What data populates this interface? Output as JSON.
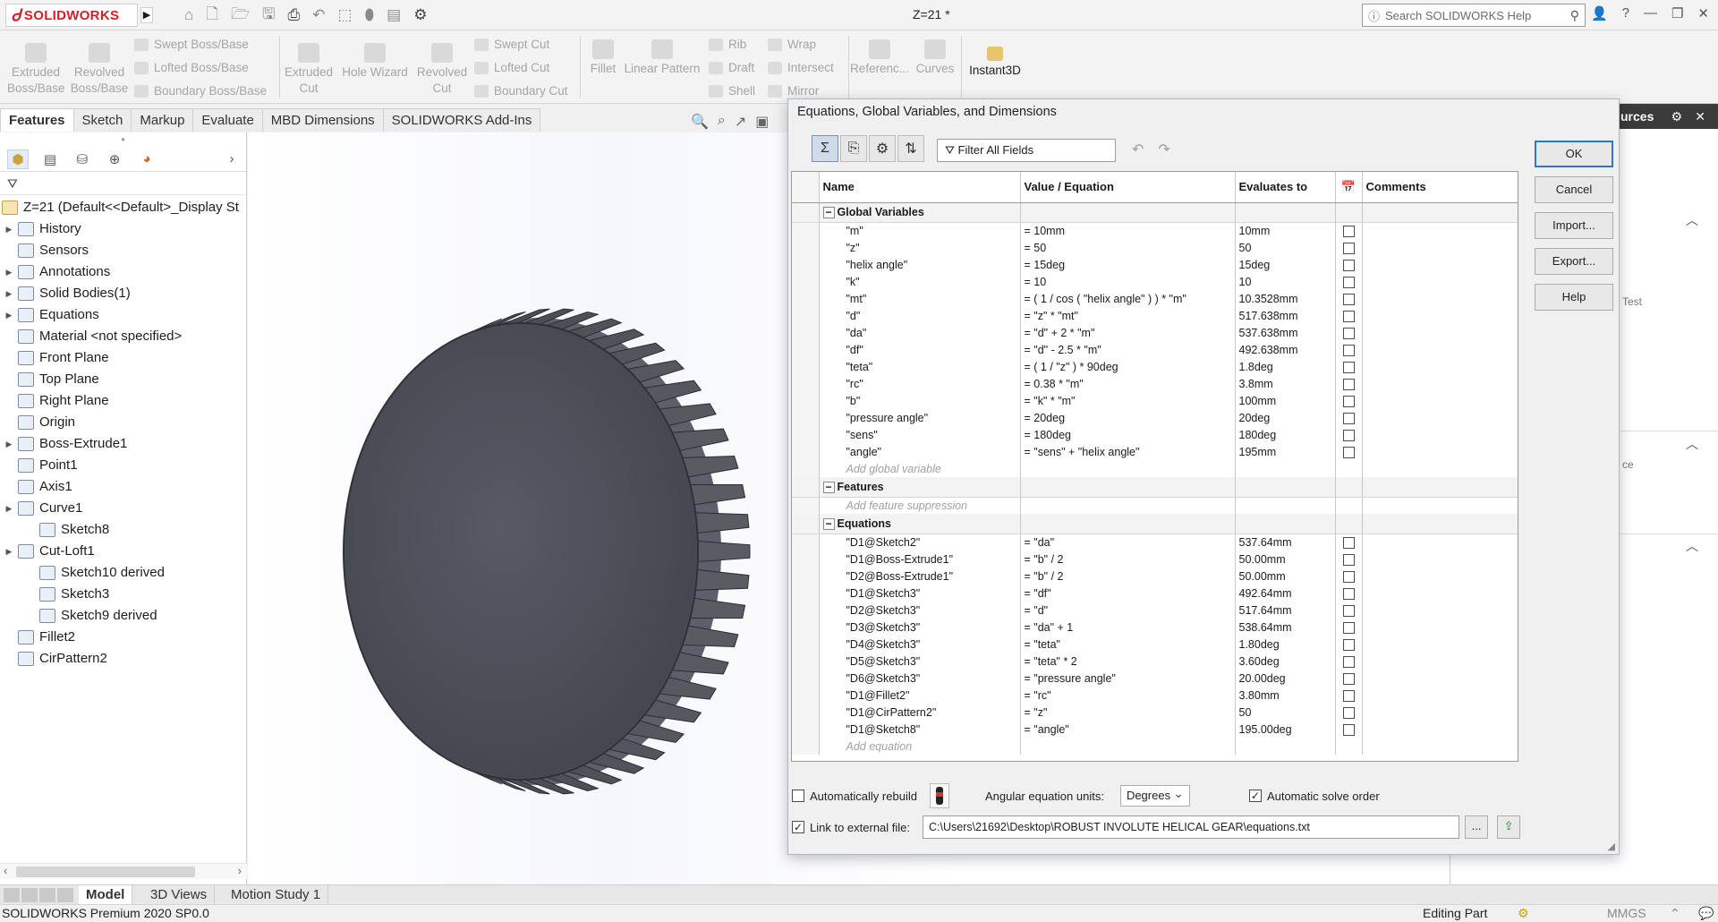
{
  "app": {
    "logo_text": "SOLIDWORKS",
    "document_title": "Z=21 *",
    "search_placeholder": "Search SOLIDWORKS Help"
  },
  "command_manager": {
    "extruded_boss": "Extruded\nBoss/Base",
    "revolved_boss": "Revolved\nBoss/Base",
    "swept_boss": "Swept Boss/Base",
    "lofted_boss": "Lofted Boss/Base",
    "boundary_boss": "Boundary Boss/Base",
    "extruded_cut": "Extruded\nCut",
    "hole_wizard": "Hole Wizard",
    "revolved_cut": "Revolved\nCut",
    "swept_cut": "Swept Cut",
    "lofted_cut": "Lofted Cut",
    "boundary_cut": "Boundary Cut",
    "fillet": "Fillet",
    "linear_pattern": "Linear Pattern",
    "rib": "Rib",
    "draft": "Draft",
    "shell": "Shell",
    "wrap": "Wrap",
    "intersect": "Intersect",
    "mirror": "Mirror",
    "reference": "Referenc...",
    "curves": "Curves",
    "instant3d": "Instant3D"
  },
  "tabs": [
    "Features",
    "Sketch",
    "Markup",
    "Evaluate",
    "MBD Dimensions",
    "SOLIDWORKS Add-Ins"
  ],
  "feature_tree": {
    "root": "Z=21  (Default<<Default>_Display St",
    "items": [
      {
        "label": "History",
        "expand": true,
        "indent": 0
      },
      {
        "label": "Sensors",
        "expand": false,
        "indent": 0
      },
      {
        "label": "Annotations",
        "expand": true,
        "indent": 0
      },
      {
        "label": "Solid Bodies(1)",
        "expand": true,
        "indent": 0
      },
      {
        "label": "Equations",
        "expand": true,
        "indent": 0
      },
      {
        "label": "Material <not specified>",
        "expand": false,
        "indent": 0
      },
      {
        "label": "Front Plane",
        "expand": false,
        "indent": 0
      },
      {
        "label": "Top Plane",
        "expand": false,
        "indent": 0
      },
      {
        "label": "Right Plane",
        "expand": false,
        "indent": 0
      },
      {
        "label": "Origin",
        "expand": false,
        "indent": 0
      },
      {
        "label": "Boss-Extrude1",
        "expand": true,
        "indent": 0
      },
      {
        "label": "Point1",
        "expand": false,
        "indent": 0
      },
      {
        "label": "Axis1",
        "expand": false,
        "indent": 0
      },
      {
        "label": "Curve1",
        "expand": true,
        "indent": 0
      },
      {
        "label": "Sketch8",
        "expand": false,
        "indent": 1
      },
      {
        "label": "Cut-Loft1",
        "expand": true,
        "indent": 0
      },
      {
        "label": "Sketch10 derived",
        "expand": false,
        "indent": 1
      },
      {
        "label": "Sketch3",
        "expand": false,
        "indent": 1
      },
      {
        "label": "Sketch9 derived",
        "expand": false,
        "indent": 1
      },
      {
        "label": "Fillet2",
        "expand": false,
        "indent": 0
      },
      {
        "label": "CirPattern2",
        "expand": false,
        "indent": 0
      }
    ]
  },
  "dialog": {
    "title": "Equations, Global Variables, and Dimensions",
    "filter_label": "Filter All Fields",
    "columns": {
      "name": "Name",
      "value": "Value / Equation",
      "evaluates": "Evaluates to",
      "comments": "Comments"
    },
    "sections": {
      "global_variables": "Global Variables",
      "features": "Features",
      "equations": "Equations"
    },
    "global_variables": [
      {
        "name": "\"m\"",
        "value": "= 10mm",
        "eval": "10mm"
      },
      {
        "name": "\"z\"",
        "value": "= 50",
        "eval": "50"
      },
      {
        "name": "\"helix angle\"",
        "value": "= 15deg",
        "eval": "15deg"
      },
      {
        "name": "\"k\"",
        "value": "= 10",
        "eval": "10"
      },
      {
        "name": "\"mt\"",
        "value": "= ( 1 / cos ( \"helix angle\" ) ) * \"m\"",
        "eval": "10.3528mm"
      },
      {
        "name": "\"d\"",
        "value": "= \"z\" * \"mt\"",
        "eval": "517.638mm"
      },
      {
        "name": "\"da\"",
        "value": "= \"d\" + 2 * \"m\"",
        "eval": "537.638mm"
      },
      {
        "name": "\"df\"",
        "value": "= \"d\" - 2.5 * \"m\"",
        "eval": "492.638mm"
      },
      {
        "name": "\"teta\"",
        "value": "= ( 1 / \"z\" ) * 90deg",
        "eval": "1.8deg"
      },
      {
        "name": "\"rc\"",
        "value": "= 0.38 * \"m\"",
        "eval": "3.8mm"
      },
      {
        "name": "\"b\"",
        "value": "= \"k\" * \"m\"",
        "eval": "100mm"
      },
      {
        "name": "\"pressure angle\"",
        "value": "= 20deg",
        "eval": "20deg"
      },
      {
        "name": "\"sens\"",
        "value": "= 180deg",
        "eval": "180deg"
      },
      {
        "name": "\"angle\"",
        "value": "= \"sens\" + \"helix angle\"",
        "eval": "195mm"
      }
    ],
    "add_global_variable": "Add global variable",
    "add_feature_suppression": "Add feature suppression",
    "equations": [
      {
        "name": "\"D1@Sketch2\"",
        "value": "= \"da\"",
        "eval": "537.64mm"
      },
      {
        "name": "\"D1@Boss-Extrude1\"",
        "value": "= \"b\" / 2",
        "eval": "50.00mm"
      },
      {
        "name": "\"D2@Boss-Extrude1\"",
        "value": "= \"b\" / 2",
        "eval": "50.00mm"
      },
      {
        "name": "\"D1@Sketch3\"",
        "value": "= \"df\"",
        "eval": "492.64mm"
      },
      {
        "name": "\"D2@Sketch3\"",
        "value": "= \"d\"",
        "eval": "517.64mm"
      },
      {
        "name": "\"D3@Sketch3\"",
        "value": "= \"da\" + 1",
        "eval": "538.64mm"
      },
      {
        "name": "\"D4@Sketch3\"",
        "value": "= \"teta\"",
        "eval": "1.80deg"
      },
      {
        "name": "\"D5@Sketch3\"",
        "value": "= \"teta\" * 2",
        "eval": "3.60deg"
      },
      {
        "name": "\"D6@Sketch3\"",
        "value": "= \"pressure angle\"",
        "eval": "20.00deg"
      },
      {
        "name": "\"D1@Fillet2\"",
        "value": "= \"rc\"",
        "eval": "3.80mm"
      },
      {
        "name": "\"D1@CirPattern2\"",
        "value": "= \"z\"",
        "eval": "50"
      },
      {
        "name": "\"D1@Sketch8\"",
        "value": "= \"angle\"",
        "eval": "195.00deg"
      }
    ],
    "add_equation": "Add equation",
    "buttons": {
      "ok": "OK",
      "cancel": "Cancel",
      "import": "Import...",
      "export": "Export...",
      "help": "Help"
    },
    "auto_rebuild": "Automatically rebuild",
    "angular_units_label": "Angular equation units:",
    "angular_units_value": "Degrees",
    "auto_solve": "Automatic solve order",
    "link_external": "Link to external file:",
    "external_path": "C:\\Users\\21692\\Desktop\\ROBUST INVOLUTE HELICAL GEAR\\equations.txt",
    "browse": "..."
  },
  "task_pane": {
    "header": "urces",
    "frag_test": "Test",
    "frag_ce": "ce"
  },
  "bottom_tabs": [
    "Model",
    "3D Views",
    "Motion Study 1"
  ],
  "status_bar": {
    "product": "SOLIDWORKS Premium 2020 SP0.0",
    "mode": "Editing Part",
    "units": "MMGS"
  },
  "colors": {
    "brand_red": "#d0202a",
    "gear_body": "#4a4d57",
    "ok_border": "#2a7ad5"
  }
}
